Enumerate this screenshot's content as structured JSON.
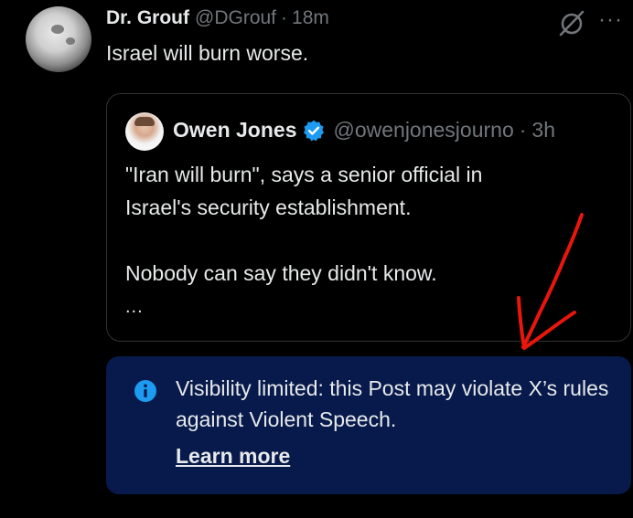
{
  "tweet": {
    "author_name": "Dr. Grouf",
    "author_handle": "@DGrouf",
    "separator": "·",
    "time": "18m",
    "text": "Israel will burn worse.",
    "more_icon": "more-horizontal-icon",
    "grok_icon": "grok-icon"
  },
  "quoted": {
    "author_name": "Owen Jones",
    "verified_icon": "verified-badge-icon",
    "author_handle": "@owenjonesjourno",
    "separator": "·",
    "time": "3h",
    "lines": [
      "\"Iran will burn\", says a senior official in",
      "Israel's security establishment.",
      "Nobody can say they didn't know."
    ],
    "ellipsis": "..."
  },
  "notice": {
    "icon": "info-icon",
    "text": "Visibility limited: this Post may violate X’s rules against Violent Speech.",
    "link": "Learn more",
    "background": "#071a4b"
  },
  "annotation": {
    "type": "red-hand-drawn-arrow",
    "color": "#e8160c"
  }
}
